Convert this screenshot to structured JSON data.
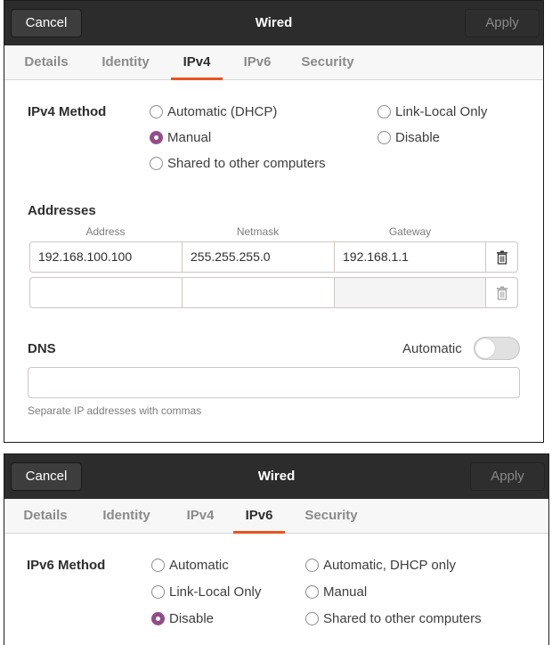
{
  "dialog1": {
    "title": "Wired",
    "cancel_label": "Cancel",
    "apply_label": "Apply",
    "tabs": [
      {
        "label": "Details",
        "active": false
      },
      {
        "label": "Identity",
        "active": false
      },
      {
        "label": "IPv4",
        "active": true
      },
      {
        "label": "IPv6",
        "active": false
      },
      {
        "label": "Security",
        "active": false
      }
    ],
    "method_label": "IPv4 Method",
    "methods": [
      {
        "label": "Automatic (DHCP)",
        "checked": false
      },
      {
        "label": "Link-Local Only",
        "checked": false
      },
      {
        "label": "Manual",
        "checked": true
      },
      {
        "label": "Disable",
        "checked": false
      },
      {
        "label": "Shared to other computers",
        "checked": false
      }
    ],
    "addresses": {
      "label": "Addresses",
      "col_address": "Address",
      "col_netmask": "Netmask",
      "col_gateway": "Gateway",
      "rows": [
        {
          "address": "192.168.100.100",
          "netmask": "255.255.255.0",
          "gateway": "192.168.1.1"
        },
        {
          "address": "",
          "netmask": "",
          "gateway": ""
        }
      ]
    },
    "dns": {
      "label": "DNS",
      "automatic_label": "Automatic",
      "automatic_on": false,
      "value": "",
      "hint": "Separate IP addresses with commas"
    }
  },
  "dialog2": {
    "title": "Wired",
    "cancel_label": "Cancel",
    "apply_label": "Apply",
    "tabs": [
      {
        "label": "Details",
        "active": false
      },
      {
        "label": "Identity",
        "active": false
      },
      {
        "label": "IPv4",
        "active": false
      },
      {
        "label": "IPv6",
        "active": true
      },
      {
        "label": "Security",
        "active": false
      }
    ],
    "method_label": "IPv6 Method",
    "methods": [
      {
        "label": "Automatic",
        "checked": false
      },
      {
        "label": "Automatic, DHCP only",
        "checked": false
      },
      {
        "label": "Link-Local Only",
        "checked": false
      },
      {
        "label": "Manual",
        "checked": false
      },
      {
        "label": "Disable",
        "checked": true
      },
      {
        "label": "Shared to other computers",
        "checked": false
      }
    ]
  },
  "colors": {
    "accent_tab": "#e95420",
    "radio_checked": "#924d8b",
    "titlebar": "#2c2c2c"
  },
  "icons": [
    "trash-icon"
  ]
}
